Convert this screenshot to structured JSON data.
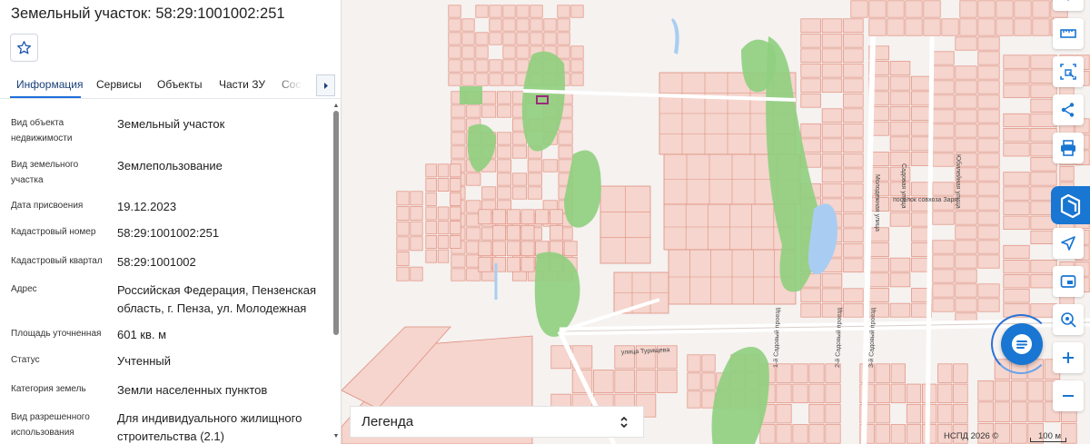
{
  "panel": {
    "title": "Земельный участок: 58:29:1001002:251",
    "tabs": [
      {
        "label": "Информация",
        "active": true
      },
      {
        "label": "Сервисы",
        "active": false
      },
      {
        "label": "Объекты",
        "active": false
      },
      {
        "label": "Части ЗУ",
        "active": false
      },
      {
        "label": "Состав",
        "active": false
      }
    ],
    "fields": [
      {
        "label": "Вид объекта недвижимости",
        "value": "Земельный участок"
      },
      {
        "label": "Вид земельного участка",
        "value": "Землепользование"
      },
      {
        "label": "Дата присвоения",
        "value": "19.12.2023"
      },
      {
        "label": "Кадастровый номер",
        "value": "58:29:1001002:251"
      },
      {
        "label": "Кадастровый квартал",
        "value": "58:29:1001002"
      },
      {
        "label": "Адрес",
        "value": "Российская Федерация, Пензенская область, г. Пенза, ул. Молодежная"
      },
      {
        "label": "Площадь уточненная",
        "value": "601 кв. м"
      },
      {
        "label": "Статус",
        "value": "Учтенный"
      },
      {
        "label": "Категория земель",
        "value": "Земли населенных пунктов"
      },
      {
        "label": "Вид разрешенного использования",
        "value": "Для индивидуального жилищного строительства (2.1)"
      }
    ],
    "scroll_position": 0.0
  },
  "map": {
    "street_labels": [
      "улица Турищева",
      "Молодежная улица",
      "Садовая улица",
      "Юбилейная улица",
      "поселок совхоза Заря",
      "1-й Садовый проезд",
      "2-й Садовый проезд",
      "3-й Садовый проезд"
    ],
    "legend_label": "Легенда",
    "copyright": "НСПД 2026 ©",
    "scale_label": "100 м"
  },
  "toolbar": {
    "tools": [
      "ruler-icon",
      "select-area-icon",
      "share-icon",
      "print-icon",
      "nspd-logo-icon",
      "locate-icon",
      "layers-icon",
      "geolocation-icon",
      "zoom-in-icon",
      "zoom-out-icon"
    ],
    "chat": "chat-icon"
  },
  "colors": {
    "accent": "#1976d2",
    "parcel_fill": "#f5d5cd",
    "parcel_stroke": "#e08f80",
    "greenery": "#8fcf7e",
    "water": "#a9cdf2",
    "selected_parcel": "#9b2c7a"
  }
}
